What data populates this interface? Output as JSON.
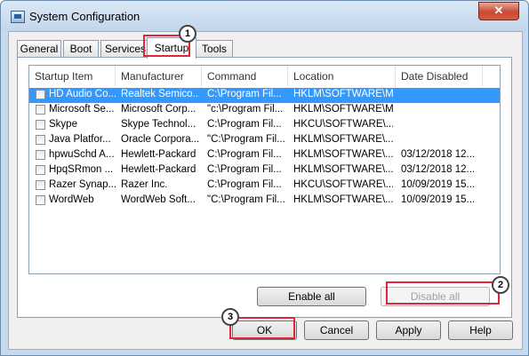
{
  "window": {
    "title": "System Configuration",
    "close_glyph": "✕"
  },
  "tabs": [
    {
      "label": "General"
    },
    {
      "label": "Boot"
    },
    {
      "label": "Services"
    },
    {
      "label": "Startup"
    },
    {
      "label": "Tools"
    }
  ],
  "startup": {
    "columns": [
      "Startup Item",
      "Manufacturer",
      "Command",
      "Location",
      "Date Disabled"
    ],
    "rows": [
      [
        "HD Audio Co...",
        "Realtek Semico...",
        "C:\\Program Fil...",
        "HKLM\\SOFTWARE\\M...",
        ""
      ],
      [
        "Microsoft Se...",
        "Microsoft Corp...",
        "\"c:\\Program Fil...",
        "HKLM\\SOFTWARE\\M...",
        ""
      ],
      [
        "Skype",
        "Skype Technol...",
        "C:\\Program Fil...",
        "HKCU\\SOFTWARE\\...",
        ""
      ],
      [
        "Java Platfor...",
        "Oracle Corpora...",
        "\"C:\\Program Fil...",
        "HKLM\\SOFTWARE\\...",
        ""
      ],
      [
        "hpwuSchd A...",
        "Hewlett-Packard",
        "C:\\Program Fil...",
        "HKLM\\SOFTWARE\\...",
        "03/12/2018 12..."
      ],
      [
        "HpqSRmon ...",
        "Hewlett-Packard",
        "C:\\Program Fil...",
        "HKLM\\SOFTWARE\\...",
        "03/12/2018 12..."
      ],
      [
        "Razer Synap...",
        "Razer Inc.",
        "C:\\Program Fil...",
        "HKCU\\SOFTWARE\\...",
        "10/09/2019 15..."
      ],
      [
        "WordWeb",
        "WordWeb Soft...",
        "\"C:\\Program Fil...",
        "HKLM\\SOFTWARE\\...",
        "10/09/2019 15..."
      ]
    ],
    "enable_all": "Enable all",
    "disable_all": "Disable all"
  },
  "buttons": {
    "ok": "OK",
    "cancel": "Cancel",
    "apply": "Apply",
    "help": "Help"
  },
  "markers": [
    "1",
    "2",
    "3"
  ],
  "colors": {
    "selection": "#3399ff",
    "highlight": "#e2263a"
  }
}
